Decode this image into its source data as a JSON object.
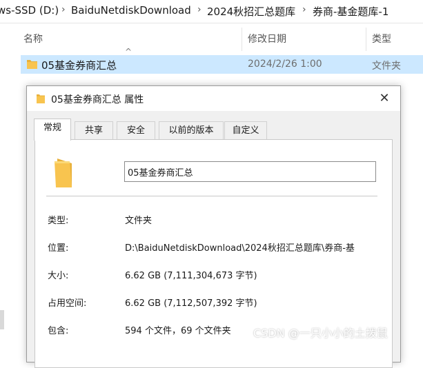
{
  "breadcrumb": {
    "items": [
      "ws-SSD (D:)",
      "BaiduNetdiskDownload",
      "2024秋招汇总题库",
      "券商-基金题库-1"
    ],
    "separator": "›"
  },
  "columns": {
    "name": "名称",
    "modified": "修改日期",
    "type": "类型"
  },
  "file_row": {
    "name": "05基金券商汇总",
    "modified": "2024/2/26 1:00",
    "type": "文件夹",
    "icon": "folder-icon"
  },
  "dialog": {
    "title": "05基金券商汇总 属性",
    "close": "✕",
    "tabs": [
      "常规",
      "共享",
      "安全",
      "以前的版本",
      "自定义"
    ],
    "active_tab": "常规",
    "name_value": "05基金券商汇总",
    "properties": [
      {
        "label": "类型:",
        "value": "文件夹"
      },
      {
        "label": "位置:",
        "value": "D:\\BaiduNetdiskDownload\\2024秋招汇总题库\\券商-基"
      },
      {
        "label": "大小:",
        "value": "6.62 GB (7,111,304,673 字节)"
      },
      {
        "label": "占用空间:",
        "value": "6.62 GB (7,112,507,392 字节)"
      },
      {
        "label": "包含:",
        "value": "594 个文件，69 个文件夹"
      }
    ]
  },
  "watermark": "CSDN @一只小小的土拨鼠",
  "colors": {
    "selection": "#cce8ff",
    "folder": "#f8c44f",
    "dialog_bg": "#f0f0f0"
  }
}
